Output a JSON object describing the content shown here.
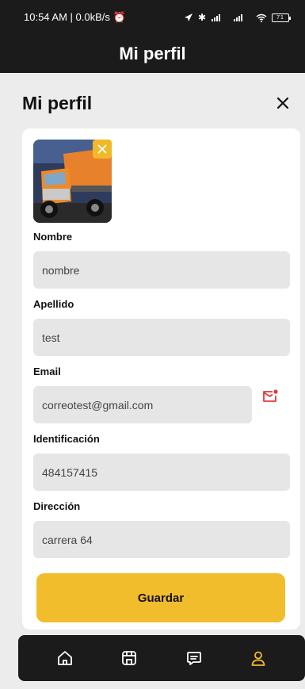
{
  "status_bar": {
    "time_speed": "10:54 AM | 0.0kB/s",
    "battery": "71"
  },
  "app_title": "Mi perfil",
  "page": {
    "title": "Mi perfil"
  },
  "form": {
    "nombre": {
      "label": "Nombre",
      "value": "nombre"
    },
    "apellido": {
      "label": "Apellido",
      "value": "test"
    },
    "email": {
      "label": "Email",
      "value": "correotest@gmail.com"
    },
    "identificacion": {
      "label": "Identificación",
      "value": "484157415"
    },
    "direccion": {
      "label": "Dirección",
      "value": "carrera 64"
    },
    "save_label": "Guardar"
  },
  "colors": {
    "accent": "#f2bd2c",
    "dark": "#1b1b1b",
    "input_bg": "#e6e6e6",
    "mail_icon": "#e53935"
  },
  "tabbar": {
    "items": [
      "home-icon",
      "store-icon",
      "chat-icon",
      "profile-icon"
    ],
    "active": "profile-icon"
  }
}
